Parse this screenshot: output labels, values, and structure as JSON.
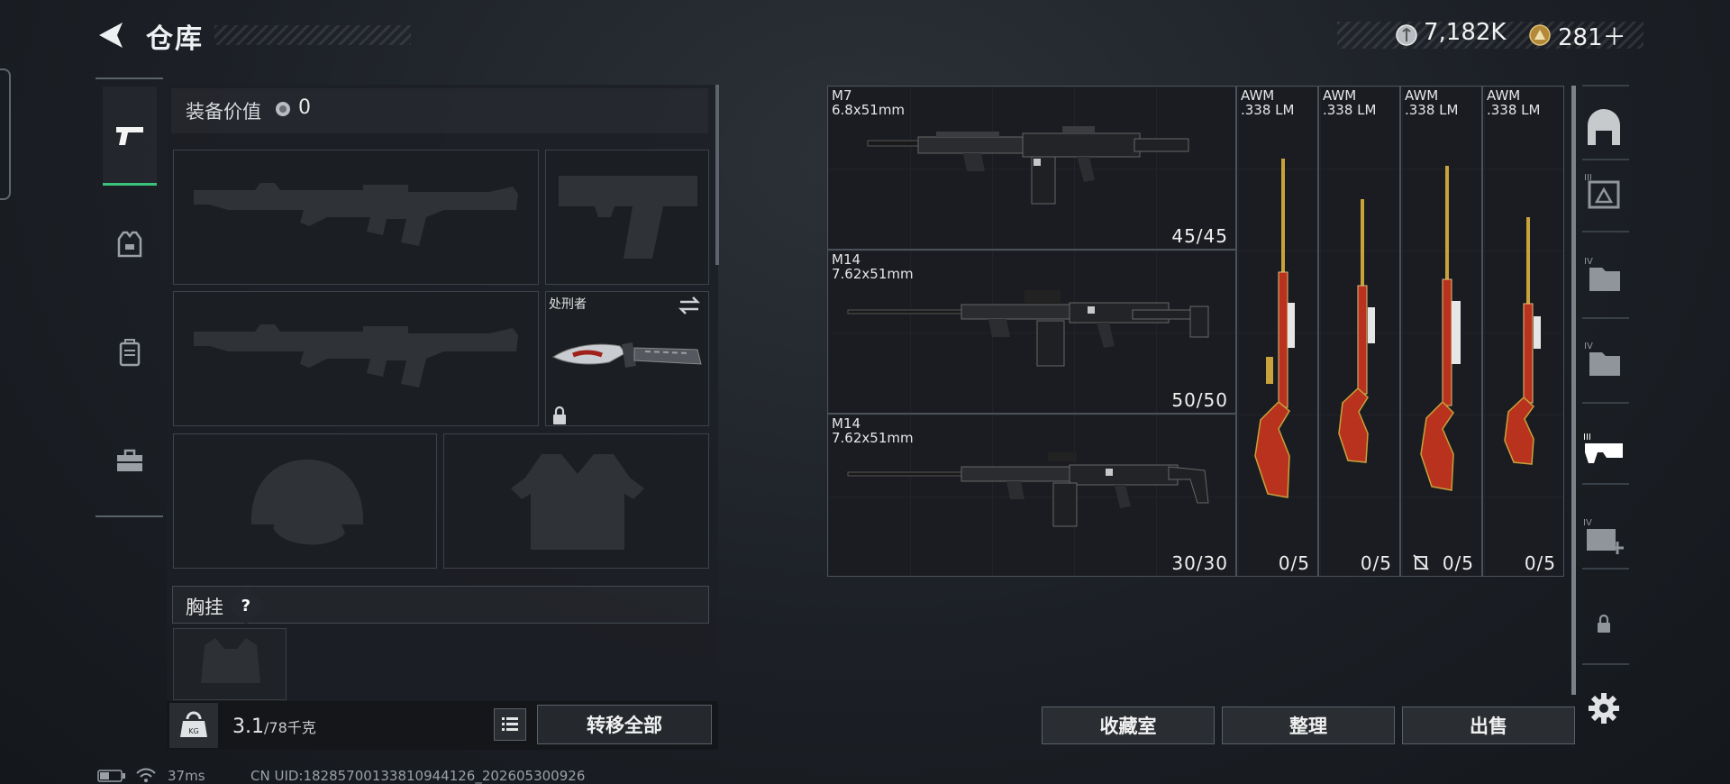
{
  "header": {
    "title": "仓库"
  },
  "currency": {
    "primary": "7,182K",
    "secondary": "281＋"
  },
  "loadout": {
    "value_label": "装备价值",
    "value": "0",
    "slots": [
      {
        "name": "primary-weapon",
        "state": "empty"
      },
      {
        "name": "sidearm",
        "state": "empty"
      },
      {
        "name": "secondary-weapon",
        "state": "empty"
      },
      {
        "name": "melee",
        "state": "equipped",
        "label": "处刑者",
        "locked": true
      },
      {
        "name": "helmet",
        "state": "empty"
      },
      {
        "name": "body-armor",
        "state": "empty"
      }
    ],
    "chest_rig_label": "胸挂",
    "help_mark": "?",
    "weight": "3.1",
    "weight_max": "/78千克",
    "transfer_all": "转移全部"
  },
  "inventory": {
    "weapons": [
      {
        "name": "M7",
        "caliber": "6.8x51mm",
        "ammo": "45/45"
      },
      {
        "name": "M14",
        "caliber": "7.62x51mm",
        "ammo": "50/50"
      },
      {
        "name": "M14",
        "caliber": "7.62x51mm",
        "ammo": "30/30"
      },
      {
        "name": "AWM",
        "caliber": ".338 LM",
        "ammo": "0/5"
      },
      {
        "name": "AWM",
        "caliber": ".338 LM",
        "ammo": "0/5"
      },
      {
        "name": "AWM",
        "caliber": ".338 LM",
        "ammo": "0/5",
        "no_ammo_flag": true
      },
      {
        "name": "AWM",
        "caliber": ".338 LM",
        "ammo": "0/5"
      }
    ]
  },
  "right_toolbar": {
    "items": [
      {
        "icon": "storage-icon"
      },
      {
        "icon": "container-iii-icon",
        "tier": "III"
      },
      {
        "icon": "folder-iv-icon",
        "tier": "IV"
      },
      {
        "icon": "folder-iv-icon",
        "tier": "IV"
      },
      {
        "icon": "weapon-rack-iii-icon",
        "tier": "III",
        "active": true
      },
      {
        "icon": "add-container-iv-icon",
        "tier": "IV"
      },
      {
        "icon": "lock-icon"
      },
      {
        "icon": "gear-icon"
      }
    ]
  },
  "actions": {
    "collection": "收藏室",
    "sort": "整理",
    "sell": "出售"
  },
  "status": {
    "ping": "37ms",
    "uid": "CN UID:1828570013381094412​6_202605300926"
  },
  "colors": {
    "accent": "#3ac27c",
    "awm_gold": "#c8a23a",
    "awm_red": "#b8321e"
  }
}
